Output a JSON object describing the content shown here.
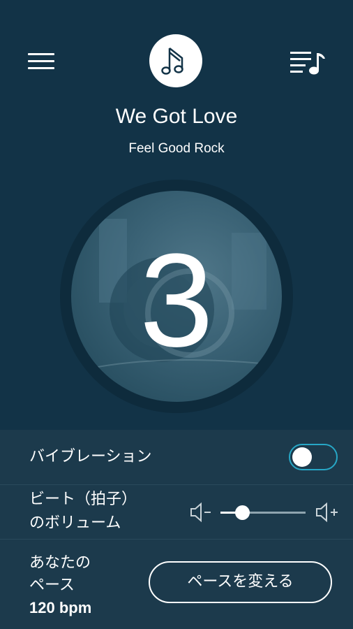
{
  "header": {
    "menu_icon": "hamburger-menu-icon",
    "logo_icon": "music-note-logo",
    "playlist_icon": "playlist-music-icon"
  },
  "song": {
    "title": "We Got Love",
    "genre": "Feel Good Rock"
  },
  "countdown": {
    "value": "3"
  },
  "settings": {
    "vibration": {
      "label": "バイブレーション",
      "enabled": false
    },
    "beat_volume": {
      "label_line1": "ビート（拍子）",
      "label_line2": "のボリューム",
      "level": 0.25,
      "decrease_icon": "volume-minus-icon",
      "increase_icon": "volume-plus-icon"
    },
    "pace": {
      "label_line1": "あなたの",
      "label_line2": "ペース",
      "value": "120 bpm",
      "button_label": "ペースを変える"
    }
  },
  "colors": {
    "background": "#123347",
    "panel": "#1c3a4c",
    "toggle_accent": "#27a7c6"
  }
}
